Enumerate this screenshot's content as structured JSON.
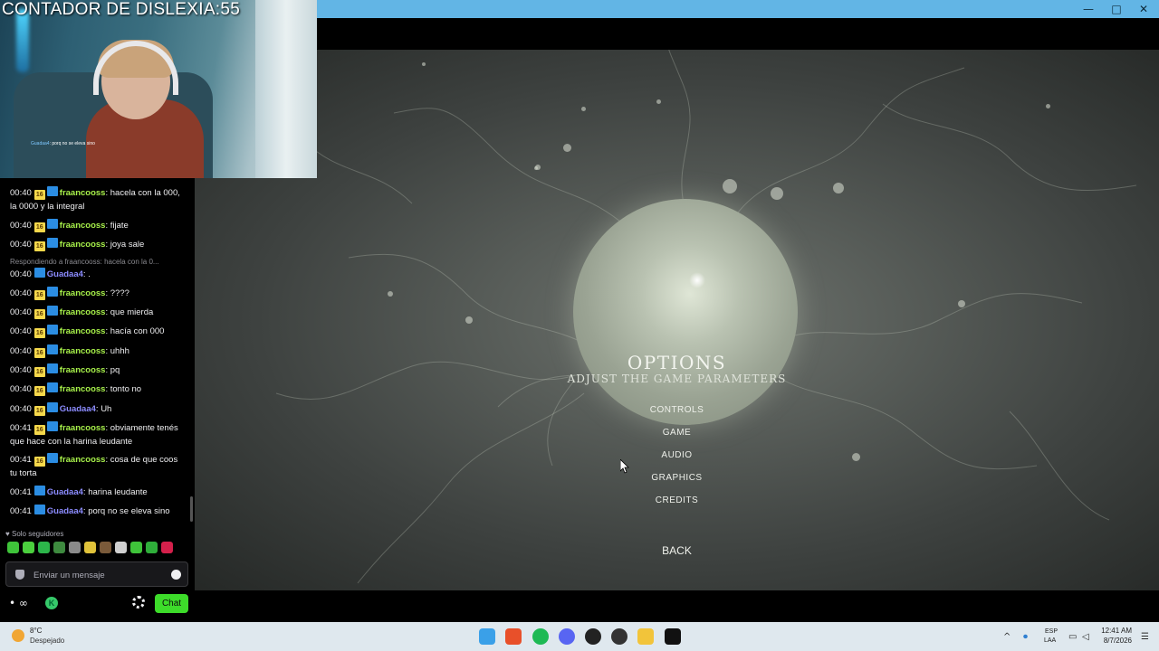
{
  "overlay": {
    "title": "CONTADOR DE DISLEXIA:55",
    "mini_user": "Guadaa4",
    "mini_text": ": porq no se eleva sino"
  },
  "game_menu": {
    "title": "OPTIONS",
    "subtitle": "ADJUST THE GAME PARAMETERS",
    "items": [
      "CONTROLS",
      "GAME",
      "AUDIO",
      "GRAPHICS",
      "CREDITS"
    ],
    "back": "BACK"
  },
  "window_controls": {
    "minimize": "—",
    "maximize": "□",
    "close": "✕"
  },
  "chat": {
    "reply_note": "Respondiendo a fraancooss: hacela con la 0...",
    "messages": [
      {
        "time": "00:40",
        "sub": "16",
        "user": "fraancooss",
        "text": ": hacela con la 000, la 0000 y la integral",
        "color": "#a7f04a"
      },
      {
        "time": "00:40",
        "sub": "16",
        "user": "fraancooss",
        "text": ": fijate",
        "color": "#a7f04a"
      },
      {
        "time": "00:40",
        "sub": "16",
        "user": "fraancooss",
        "text": ": joya sale",
        "color": "#a7f04a"
      },
      {
        "time": "00:40",
        "sub": "",
        "user": "Guadaa4",
        "text": ": .",
        "color": "#8c8cff"
      },
      {
        "time": "00:40",
        "sub": "16",
        "user": "fraancooss",
        "text": ": ????",
        "color": "#a7f04a"
      },
      {
        "time": "00:40",
        "sub": "16",
        "user": "fraancooss",
        "text": ": que mierda",
        "color": "#a7f04a"
      },
      {
        "time": "00:40",
        "sub": "16",
        "user": "fraancooss",
        "text": ": hacía con 000",
        "color": "#a7f04a"
      },
      {
        "time": "00:40",
        "sub": "16",
        "user": "fraancooss",
        "text": ": uhhh",
        "color": "#a7f04a"
      },
      {
        "time": "00:40",
        "sub": "16",
        "user": "fraancooss",
        "text": ": pq",
        "color": "#a7f04a"
      },
      {
        "time": "00:40",
        "sub": "16",
        "user": "fraancooss",
        "text": ": tonto no",
        "color": "#a7f04a"
      },
      {
        "time": "00:40",
        "sub": "16",
        "user": "Guadaa4",
        "text": ": Uh",
        "color": "#8c8cff"
      },
      {
        "time": "00:41",
        "sub": "16",
        "user": "fraancooss",
        "text": ": obviamente tenés que hace con la harina leudante",
        "color": "#a7f04a"
      },
      {
        "time": "00:41",
        "sub": "16",
        "user": "fraancooss",
        "text": ": cosa de que coos tu torta",
        "color": "#a7f04a"
      },
      {
        "time": "00:41",
        "sub": "",
        "user": "Guadaa4",
        "text": ": harina leudante",
        "color": "#8c8cff"
      },
      {
        "time": "00:41",
        "sub": "",
        "user": "Guadaa4",
        "text": ": porq no se eleva sino",
        "color": "#8c8cff"
      }
    ],
    "followers_only": "Solo seguidores",
    "input_placeholder": "Enviar un mensaje",
    "infinity": "∞",
    "chat_button": "Chat"
  },
  "taskbar": {
    "temperature": "8°C",
    "weather": "Despejado",
    "lang": "ESP",
    "lang_sub": "LAA",
    "time": "12:41 AM",
    "date": "8/7/2026"
  }
}
